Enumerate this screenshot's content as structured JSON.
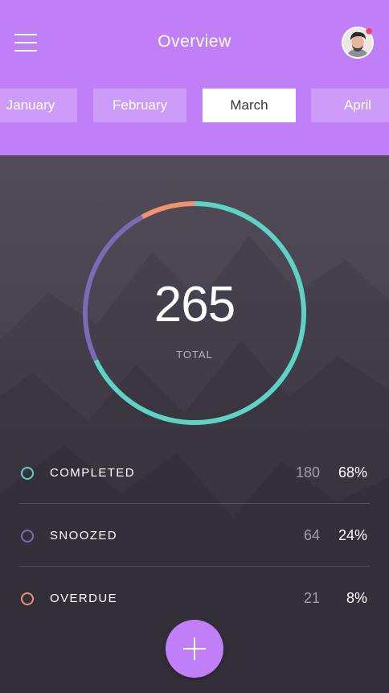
{
  "header": {
    "title": "Overview",
    "menu_icon": "hamburger-menu-icon",
    "avatar_icon": "user-avatar",
    "has_notification": true,
    "background_color": "#c17ff7"
  },
  "months": {
    "tabs": [
      "January",
      "February",
      "March",
      "April"
    ],
    "selected": "March"
  },
  "summary": {
    "total": "265",
    "total_label": "TOTAL"
  },
  "legend": [
    {
      "label": "COMPLETED",
      "count": "180",
      "percent": "68%",
      "color": "#5ed3c3"
    },
    {
      "label": "SNOOZED",
      "count": "64",
      "percent": "24%",
      "color": "#7a6bb5"
    },
    {
      "label": "OVERDUE",
      "count": "21",
      "percent": "8%",
      "color": "#ef9374"
    }
  ],
  "fab": {
    "icon": "plus-icon"
  }
}
